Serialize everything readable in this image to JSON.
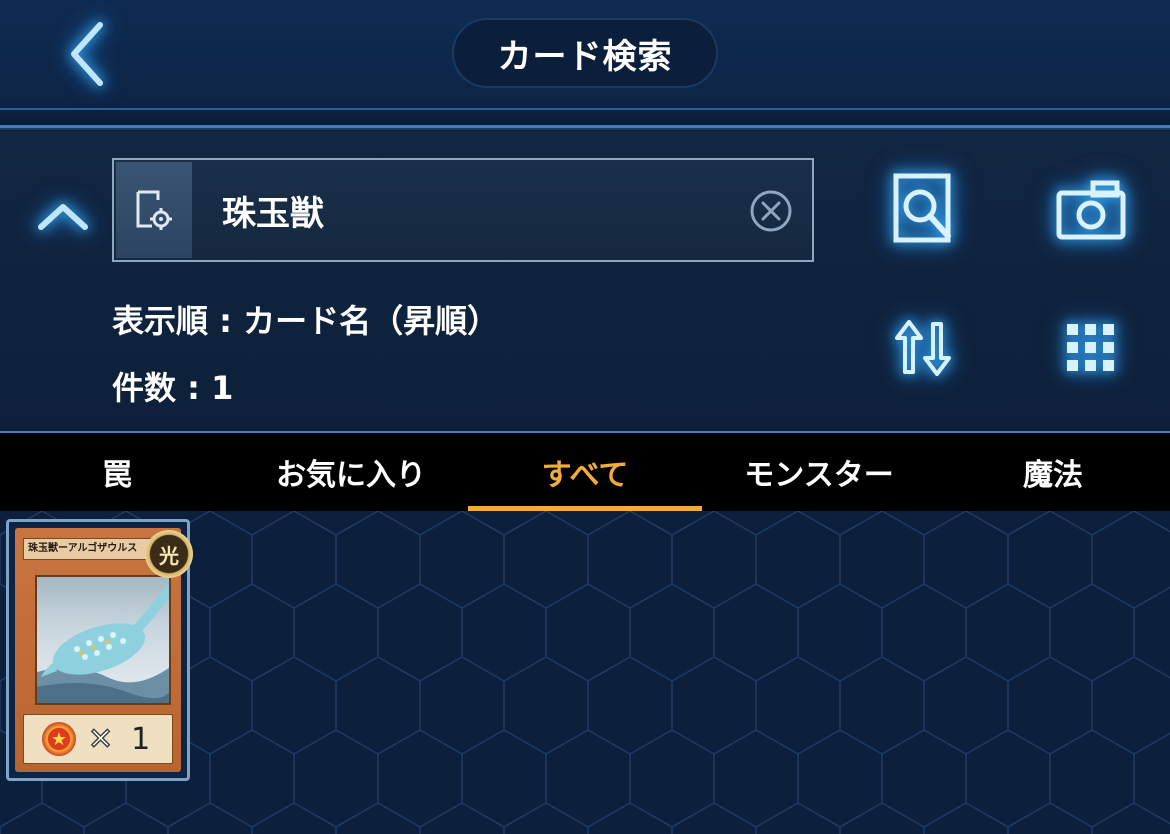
{
  "header": {
    "title": "カード検索",
    "back_icon": "chevron-left-icon"
  },
  "search": {
    "query": "珠玉獣",
    "filter_icon": "card-settings-icon",
    "clear_icon": "clear-circle-x-icon",
    "collapse_icon": "chevron-up-icon"
  },
  "actions": {
    "search_icon": "magnifier-card-icon",
    "camera_icon": "camera-icon",
    "sort_icon": "sort-arrows-icon",
    "grid_icon": "grid-view-icon"
  },
  "info": {
    "sort_line": "表示順 : カード名（昇順）",
    "count_line": "件数 : 1"
  },
  "tabs": [
    {
      "label": "罠",
      "active": false
    },
    {
      "label": "お気に入り",
      "active": false
    },
    {
      "label": "すべて",
      "active": true
    },
    {
      "label": "モンスター",
      "active": false
    },
    {
      "label": "魔法",
      "active": false
    }
  ],
  "results": [
    {
      "name": "珠玉獣ーアルゴザウルス",
      "attribute": "光",
      "quantity_x": "✕",
      "quantity": "1"
    }
  ],
  "colors": {
    "accent": "#f2ac3c",
    "glow": "#3fb3ff",
    "background": "#0b1a33"
  }
}
